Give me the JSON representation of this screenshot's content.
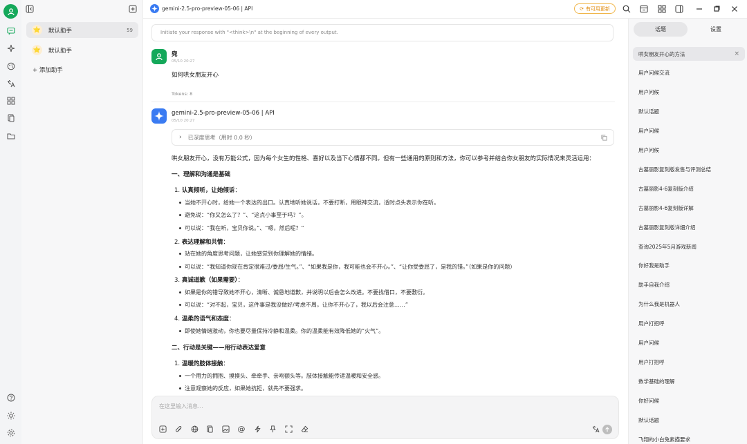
{
  "header": {
    "model_title": "gemini-2.5-pro-preview-05-06 | API",
    "update_badge": "有可用更新"
  },
  "assistants": {
    "items": [
      {
        "label": "默认助手",
        "count": "59"
      },
      {
        "label": "默认助手",
        "count": ""
      }
    ],
    "add_label": "+ 添加助手"
  },
  "chat": {
    "system_prompt": "Initiate your response with \"<think>\\n\" at the beginning of every output.",
    "user": {
      "name": "兜",
      "time": "05/10 20:27",
      "text": "如何哄女朋友开心",
      "tokens": "Tokens: 8"
    },
    "assistant": {
      "name": "gemini-2.5-pro-preview-05-06 | API",
      "time": "05/10 20:27",
      "thinking": "已深度思考（用时 0.0 秒）",
      "intro": "哄女朋友开心，没有万能公式，因为每个女生的性格、喜好以及当下心情都不同。但有一些通用的原则和方法，你可以参考并结合你女朋友的实际情况来灵活运用：",
      "section1": "一、理解和沟通是基础",
      "s1_items": [
        {
          "num": "1.",
          "title": "认真倾听，让她倾诉",
          "suffix": "：",
          "bullets": [
            "当她不开心时，给她一个表达的出口。认真地听她说话，不要打断，用眼神交流，适时点头表示你在听。",
            "避免说：“你又怎么了？”、“这点小事至于吗？”。",
            "可以说：“我在听，宝贝你说。”、“嗯，然后呢？”"
          ]
        },
        {
          "num": "2.",
          "title": "表达理解和共情",
          "suffix": "：",
          "bullets": [
            "站在她的角度思考问题，让她感觉到你理解她的情绪。",
            "可以说：“我知道你现在肯定很难过/委屈/生气。”、“如果我是你，我可能也会不开心。”、“让你受委屈了，是我的错。”（如果是你的问题）"
          ]
        },
        {
          "num": "3.",
          "title": "真诚道歉（如果需要）",
          "suffix": "：",
          "bullets": [
            "如果是你的错导致她不开心，清晰、诚恳地道歉，并说明以后会怎么改进。不要找借口，不要敷衍。",
            "可以说：“对不起，宝贝，这件事是我没做好/考虑不周，让你不开心了，我以后会注意……”"
          ]
        },
        {
          "num": "4.",
          "title": "温柔的语气和态度",
          "suffix": "：",
          "bullets": [
            "即使她情绪激动，你也要尽量保持冷静和温柔。你的温柔能有效降低她的“火气”。"
          ]
        }
      ],
      "section2": "二、行动是关键——用行动表达爱意",
      "s2_items": [
        {
          "num": "1.",
          "title": "温暖的肢体接触",
          "suffix": "：",
          "bullets": [
            "一个用力的拥抱、摸摸头、牵牵手、亲吻额头等。肢体接触能传递温暖和安全感。",
            "注意观察她的反应，如果她抗拒，就先不要强求。"
          ]
        }
      ]
    },
    "input_placeholder": "在这里输入消息..."
  },
  "right_panel": {
    "tabs": [
      "话题",
      "设置"
    ],
    "topics": [
      "哄女朋友开心的方法",
      "用户问候交流",
      "用户问候",
      "默认话题",
      "用户问候",
      "用户问候",
      "古墓丽影复刻版发售与评测总结",
      "古墓丽影4-6复刻版介绍",
      "古墓丽影4-6复刻版详解",
      "古墓丽影复刻版详细介绍",
      "查询2025年5月游戏新闻",
      "你好我是助手",
      "助手自我介绍",
      "为什么我是机器人",
      "用户打招呼",
      "用户问候",
      "用户打招呼",
      "数学基础的理解",
      "你好问候",
      "默认话题",
      "飞翔的小白兔素描要求"
    ]
  },
  "colors": {
    "accent_green": "#14a85a",
    "gemini_blue": "#3a7bf2",
    "update_orange": "#e08c0f"
  }
}
